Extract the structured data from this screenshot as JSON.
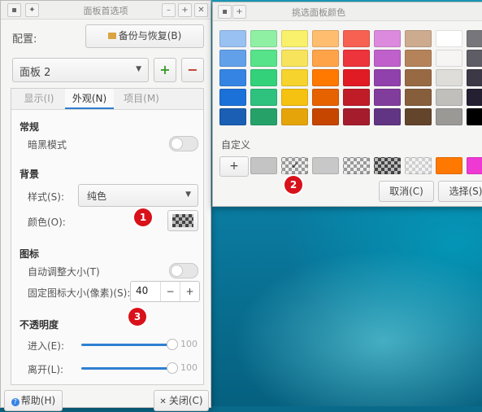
{
  "panel_prefs": {
    "title": "面板首选项",
    "config_label": "配置:",
    "backup_button": "备份与恢复(B)",
    "panel_select": "面板 2",
    "add_symbol": "+",
    "remove_symbol": "−",
    "tabs": [
      "显示(I)",
      "外观(N)",
      "项目(M)"
    ],
    "active_tab": "外观(N)",
    "general": {
      "heading": "常规",
      "dark_mode": "暗黑模式"
    },
    "background": {
      "heading": "背景",
      "style_label": "样式(S):",
      "style_value": "纯色",
      "color_label": "颜色(O):"
    },
    "icons": {
      "heading": "图标",
      "auto_size": "自动调整大小(T)",
      "fixed_size_label": "固定图标大小(像素)(S):",
      "fixed_size_value": "40",
      "minus": "−",
      "plus": "+"
    },
    "opacity": {
      "heading": "不透明度",
      "enter_label": "进入(E):",
      "enter_value": "100",
      "leave_label": "离开(L):",
      "leave_value": "100"
    },
    "help_button": "帮助(H)",
    "close_button": "关闭(C)"
  },
  "color_picker": {
    "title": "挑选面板颜色",
    "palette": [
      [
        "#99c1f1",
        "#8ff0a4",
        "#f9f06b",
        "#ffbe6f",
        "#f66151",
        "#dc8add",
        "#cdab8f",
        "#ffffff",
        "#77767b"
      ],
      [
        "#62a0ea",
        "#57e389",
        "#f8e45c",
        "#ffa348",
        "#ed333b",
        "#c061cb",
        "#b5835a",
        "#f6f5f4",
        "#5e5c64"
      ],
      [
        "#3584e4",
        "#33d17a",
        "#f6d32d",
        "#ff7800",
        "#e01b24",
        "#9141ac",
        "#986a44",
        "#deddda",
        "#3d3846"
      ],
      [
        "#1c71d8",
        "#2ec27e",
        "#f5c211",
        "#e66100",
        "#c01c28",
        "#813d9c",
        "#865e3c",
        "#c0bfbc",
        "#241f31"
      ],
      [
        "#1a5fb4",
        "#26a269",
        "#e5a50a",
        "#c64600",
        "#a51d2d",
        "#613583",
        "#63452c",
        "#9a9996",
        "#000000"
      ]
    ],
    "custom_label": "自定义",
    "add_custom": "+",
    "cancel_button": "取消(C)",
    "select_button": "选择(S)"
  },
  "markers": [
    "1",
    "2",
    "3"
  ],
  "colors": {
    "accent": "#2f7fd1",
    "marker_red": "#d8111a",
    "custom_orange": "#ff7800",
    "custom_magenta": "#ee3ad2"
  }
}
